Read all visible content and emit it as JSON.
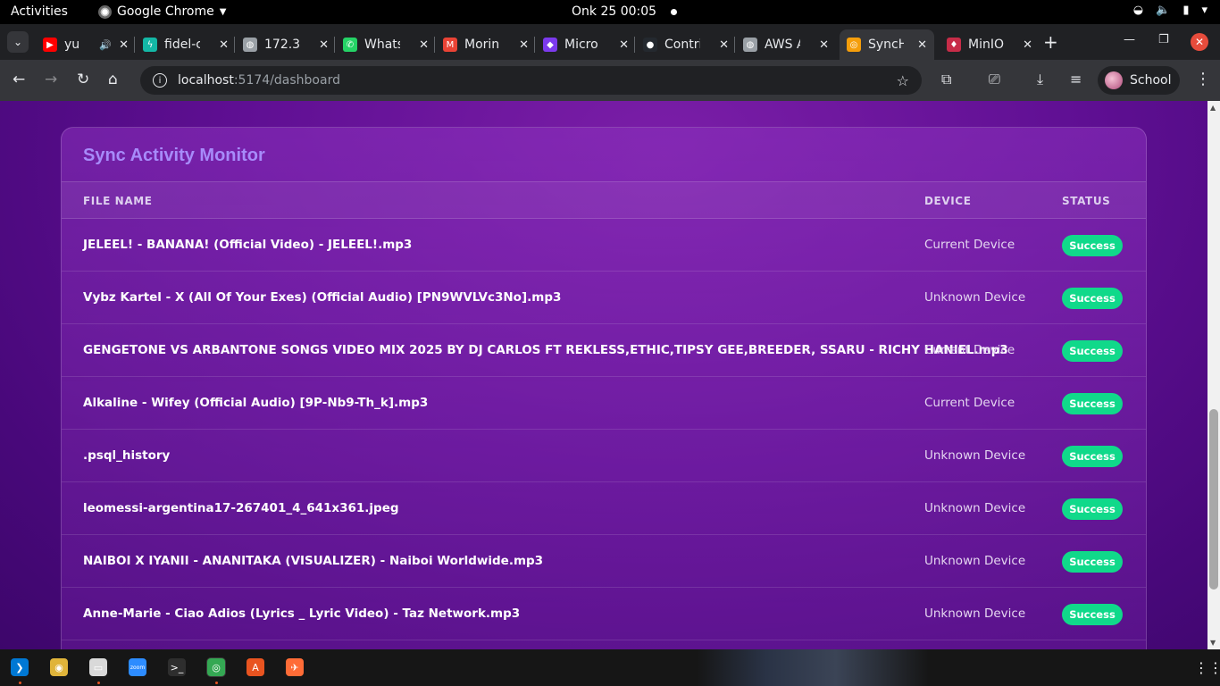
{
  "topbar": {
    "activities": "Activities",
    "app_name": "Google Chrome",
    "clock": "Onk 25  00:05"
  },
  "tabs": [
    {
      "title": "yu",
      "favicon": "youtube-icon",
      "color": "#ff0000"
    },
    {
      "title": "fidel-c",
      "favicon": "bolt-icon",
      "color": "#14b8a6"
    },
    {
      "title": "172.3",
      "favicon": "globe-icon",
      "color": "#9aa0a6"
    },
    {
      "title": "Whats",
      "favicon": "whatsapp-icon",
      "color": "#25d366"
    },
    {
      "title": "Morin",
      "favicon": "gmail-icon",
      "color": "#ea4335"
    },
    {
      "title": "Micro",
      "favicon": "copilot-icon",
      "color": "#7c3aed"
    },
    {
      "title": "Contri",
      "favicon": "github-icon",
      "color": "#24292f"
    },
    {
      "title": "AWS A",
      "favicon": "globe-icon",
      "color": "#9aa0a6"
    },
    {
      "title": "SyncH",
      "favicon": "sync-icon",
      "color": "#f59e0b"
    },
    {
      "title": "MinIO",
      "favicon": "minio-icon",
      "color": "#c72c48"
    }
  ],
  "toolbar": {
    "url_host": "localhost",
    "url_path": ":5174/dashboard",
    "profile_name": "School"
  },
  "monitor": {
    "title": "Sync Activity Monitor",
    "columns": {
      "file_name": "FILE NAME",
      "device": "DEVICE",
      "status": "STATUS"
    },
    "rows": [
      {
        "file": "JELEEL! - BANANA! (Official Video) - JELEEL!.mp3",
        "device": "Current Device",
        "status": "Success"
      },
      {
        "file": "Vybz Kartel - X (All Of Your Exes) (Official Audio) [PN9WVLVc3No].mp3",
        "device": "Unknown Device",
        "status": "Success"
      },
      {
        "file": "GENGETONE VS ARBANTONE SONGS VIDEO MIX 2025 BY DJ CARLOS FT REKLESS,ETHIC,TIPSY GEE,BREEDER, SSARU - RICHY HANIEL.mp3",
        "device": "Current Device",
        "status": "Success"
      },
      {
        "file": "Alkaline - Wifey (Official Audio) [9P-Nb9-Th_k].mp3",
        "device": "Current Device",
        "status": "Success"
      },
      {
        "file": ".psql_history",
        "device": "Unknown Device",
        "status": "Success"
      },
      {
        "file": "leomessi-argentina17-267401_4_641x361.jpeg",
        "device": "Unknown Device",
        "status": "Success"
      },
      {
        "file": "NAIBOI X IYANII - ANANITAKA (VISUALIZER) - Naiboi Worldwide.mp3",
        "device": "Unknown Device",
        "status": "Success"
      },
      {
        "file": "Anne-Marie - Ciao Adios (Lyrics _ Lyric Video) - Taz Network.mp3",
        "device": "Unknown Device",
        "status": "Success"
      }
    ]
  },
  "colors": {
    "accent": "#a78bfa",
    "success": "#10d98a",
    "page_bg": "#5f0f93"
  },
  "dock": [
    {
      "name": "vscode-icon",
      "color": "#0078d4"
    },
    {
      "name": "rhythmbox-icon",
      "color": "#e0b43a"
    },
    {
      "name": "files-icon",
      "color": "#d9d9d9"
    },
    {
      "name": "zoom-icon",
      "color": "#2d8cff",
      "label": "zoom"
    },
    {
      "name": "terminal-icon",
      "color": "#2e2e2e"
    },
    {
      "name": "chrome-icon",
      "color": "#34a853"
    },
    {
      "name": "app-center-icon",
      "color": "#e95420"
    },
    {
      "name": "postman-icon",
      "color": "#ff6c37"
    }
  ]
}
